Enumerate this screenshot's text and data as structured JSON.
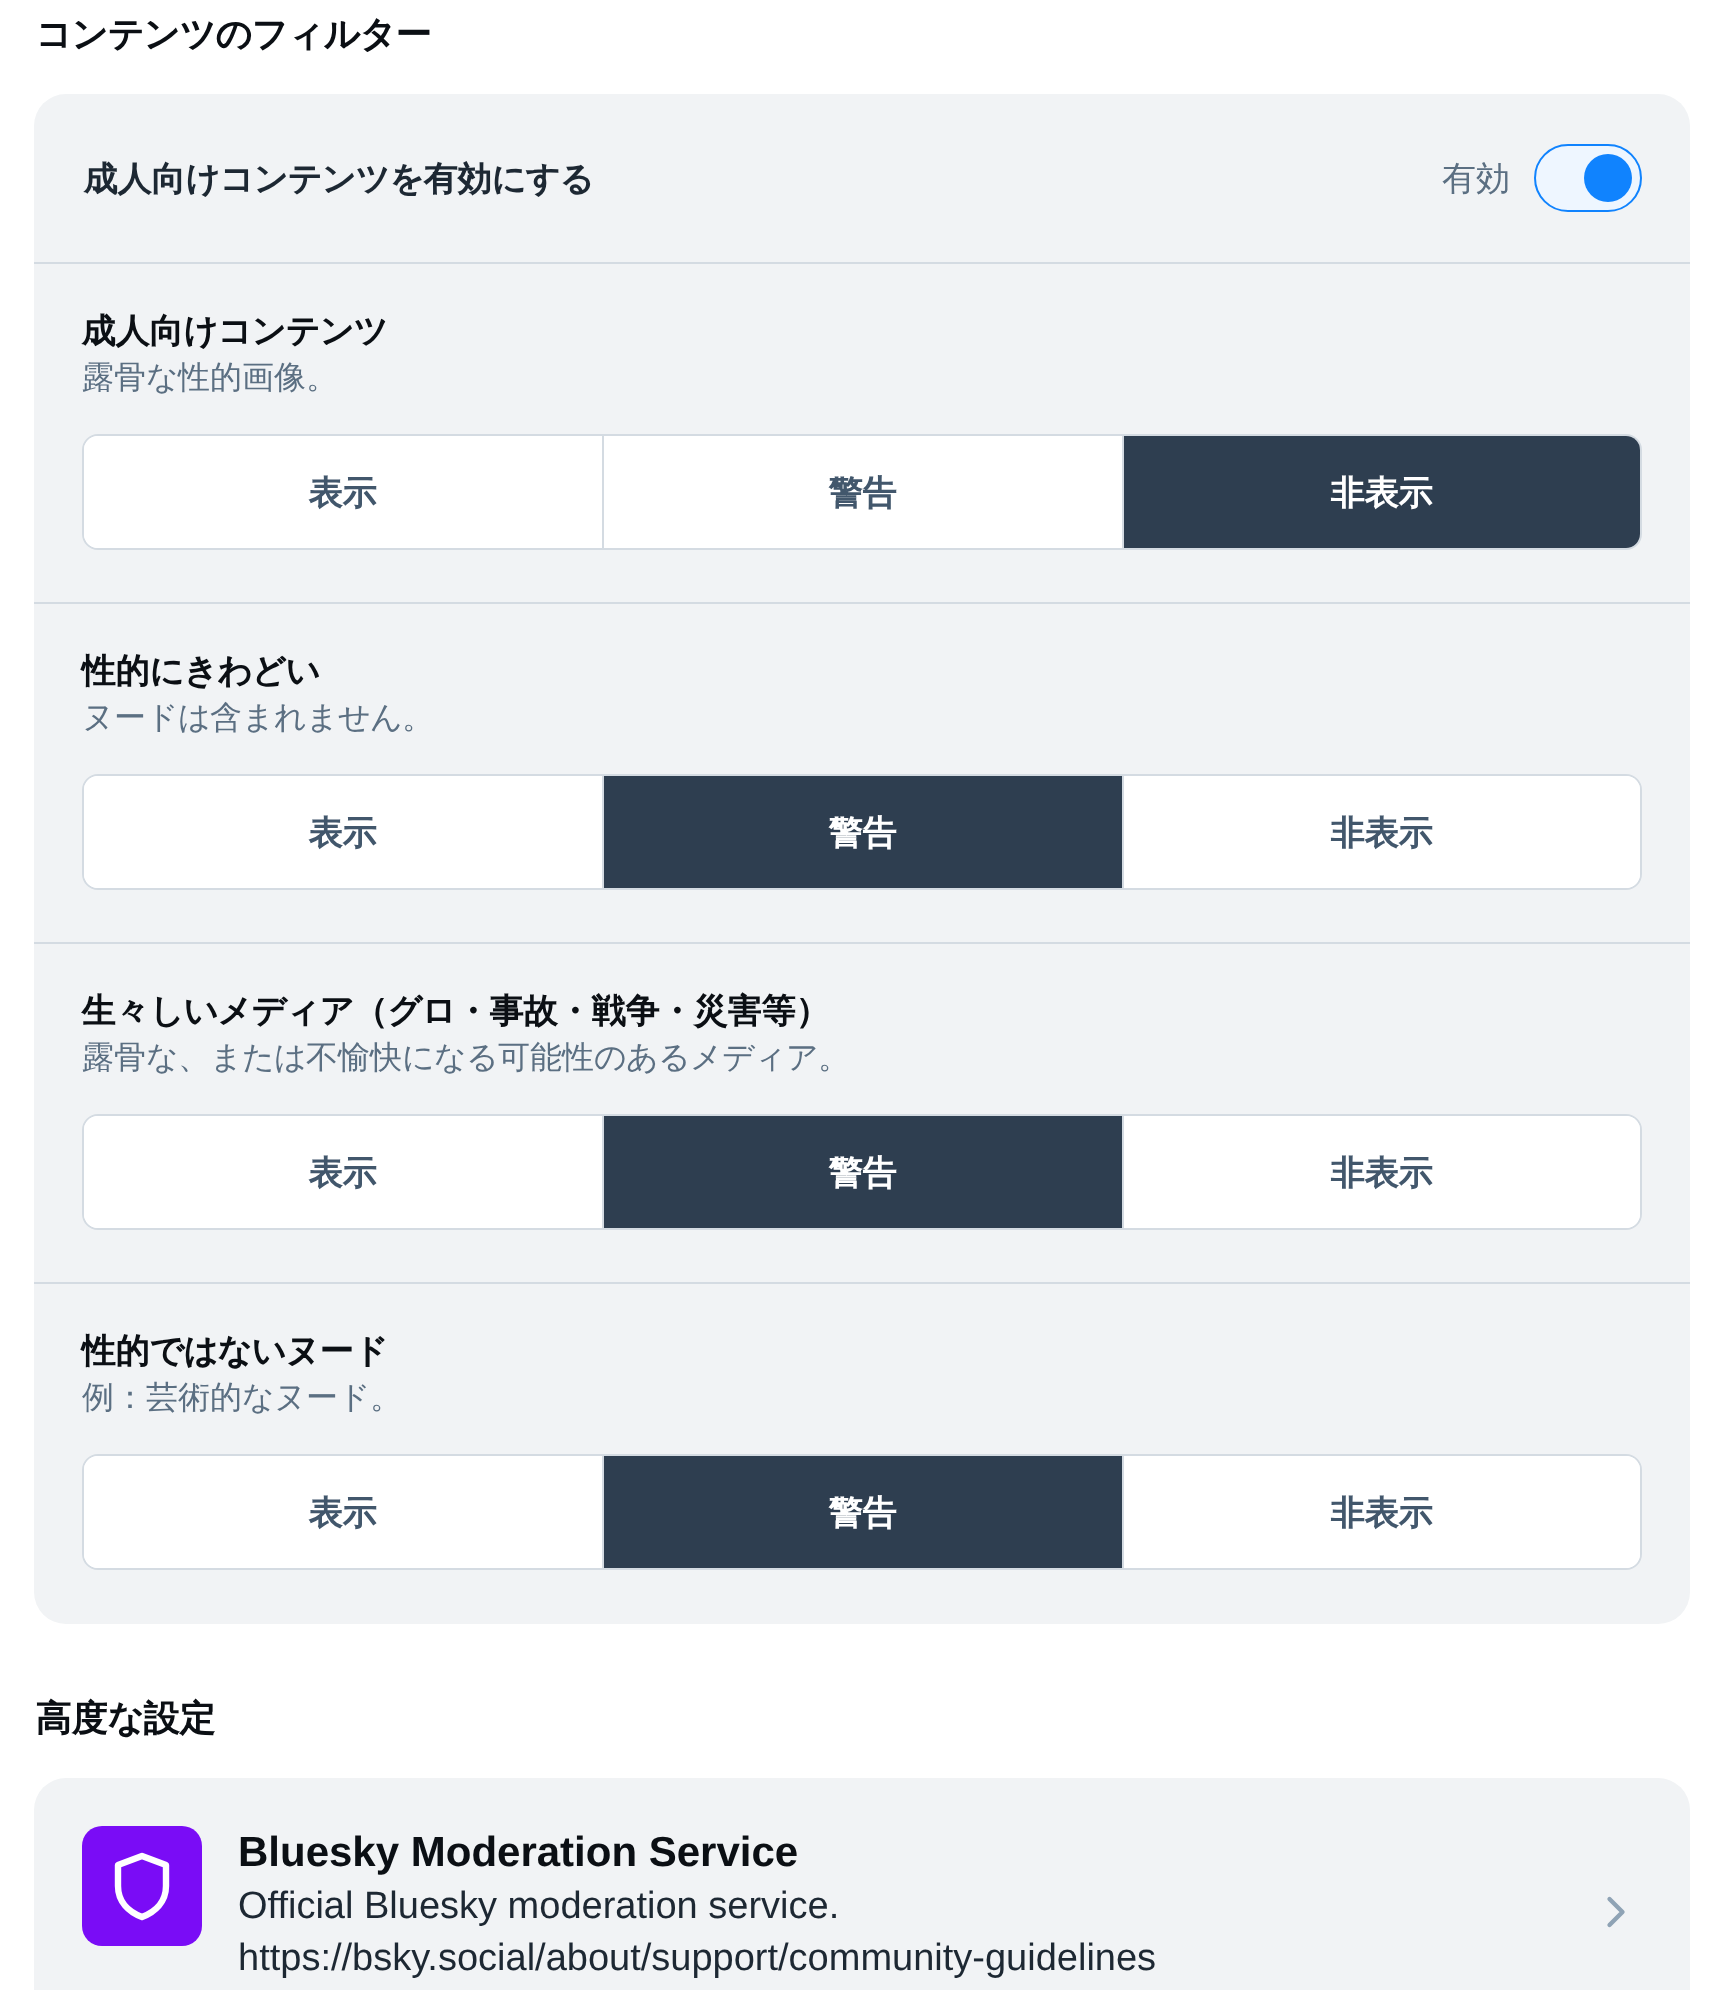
{
  "content_filters": {
    "heading": "コンテンツのフィルター",
    "adult_toggle": {
      "label": "成人向けコンテンツを有効にする",
      "state_label": "有効",
      "on": true
    },
    "categories": [
      {
        "title": "成人向けコンテンツ",
        "description": "露骨な性的画像。",
        "options": [
          {
            "label": "表示",
            "selected": false
          },
          {
            "label": "警告",
            "selected": false
          },
          {
            "label": "非表示",
            "selected": true
          }
        ]
      },
      {
        "title": "性的にきわどい",
        "description": "ヌードは含まれません。",
        "options": [
          {
            "label": "表示",
            "selected": false
          },
          {
            "label": "警告",
            "selected": true
          },
          {
            "label": "非表示",
            "selected": false
          }
        ]
      },
      {
        "title": "生々しいメディア（グロ・事故・戦争・災害等）",
        "description": "露骨な、または不愉快になる可能性のあるメディア。",
        "options": [
          {
            "label": "表示",
            "selected": false
          },
          {
            "label": "警告",
            "selected": true
          },
          {
            "label": "非表示",
            "selected": false
          }
        ]
      },
      {
        "title": "性的ではないヌード",
        "description": "例：芸術的なヌード。",
        "options": [
          {
            "label": "表示",
            "selected": false
          },
          {
            "label": "警告",
            "selected": true
          },
          {
            "label": "非表示",
            "selected": false
          }
        ]
      }
    ]
  },
  "advanced": {
    "heading": "高度な設定",
    "services": [
      {
        "name": "Bluesky Moderation Service",
        "description": "Official Bluesky moderation service.",
        "url": "https://bsky.social/about/support/community-guidelines"
      }
    ]
  }
}
